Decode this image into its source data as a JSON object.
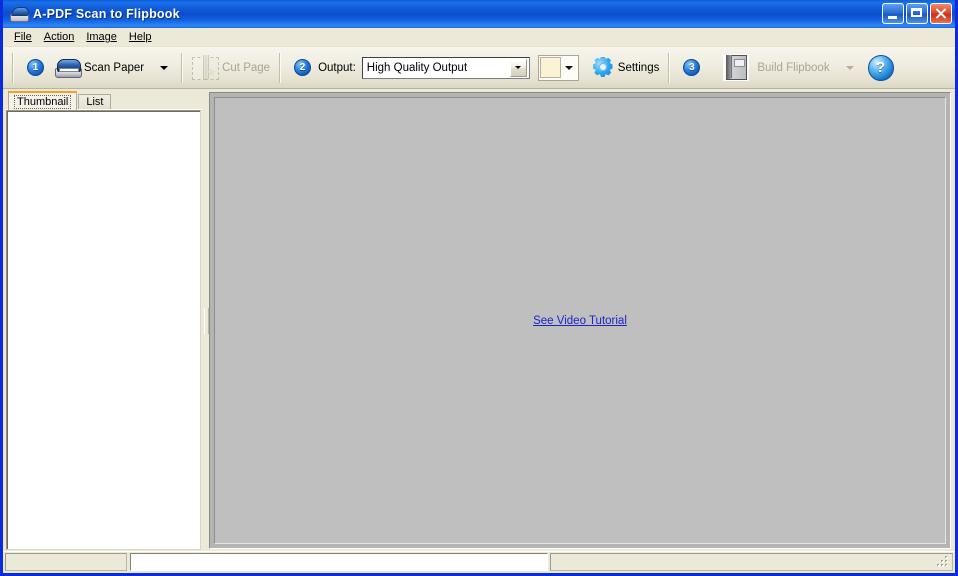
{
  "window": {
    "title": "A-PDF Scan to Flipbook",
    "title_icon": "scanner-icon",
    "controls": {
      "minimize": "minimize-button",
      "maximize": "maximize-button",
      "close": "close-button"
    }
  },
  "menubar": {
    "items": [
      {
        "label": "File",
        "accel": "F"
      },
      {
        "label": "Action",
        "accel": "A"
      },
      {
        "label": "Image",
        "accel": "I"
      },
      {
        "label": "Help",
        "accel": "H"
      }
    ]
  },
  "toolbar": {
    "step1_badge": "1",
    "scan_paper_label": "Scan Paper",
    "scan_paper_icon": "scanner-icon",
    "scan_paper_dropdown_icon": "chevron-down-icon",
    "cut_page_label": "Cut Page",
    "cut_page_icon": "cut-page-icon",
    "cut_page_enabled": false,
    "step2_badge": "2",
    "output_label": "Output:",
    "output_value": "High Quality Output",
    "output_options": [
      "High Quality Output"
    ],
    "color_swatch": "#FBF3D4",
    "color_dropdown_icon": "chevron-down-icon",
    "settings_label": "Settings",
    "settings_icon": "gear-icon",
    "step3_badge": "3",
    "build_flipbook_label": "Build Flipbook",
    "build_flipbook_icon": "book-icon",
    "build_flipbook_enabled": false,
    "build_dropdown_icon": "chevron-down-icon",
    "help_label": "?",
    "help_icon": "help-icon"
  },
  "left_panel": {
    "tabs": [
      {
        "label": "Thumbnail",
        "active": true
      },
      {
        "label": "List",
        "active": false
      }
    ],
    "thumbnail_list": []
  },
  "viewer": {
    "video_tutorial_link": "See Video Tutorial",
    "background_color": "#BFBFBF"
  },
  "statusbar": {
    "left_text": "",
    "field_text": "",
    "right_text": "",
    "grip_icon": "resize-grip-icon"
  },
  "colors": {
    "titlebar_blue": "#0B4FD0",
    "window_border": "#0A2CE0",
    "chrome": "#ECE9D8",
    "accent_orange": "#F0A22E",
    "link_blue": "#1A24C8"
  }
}
